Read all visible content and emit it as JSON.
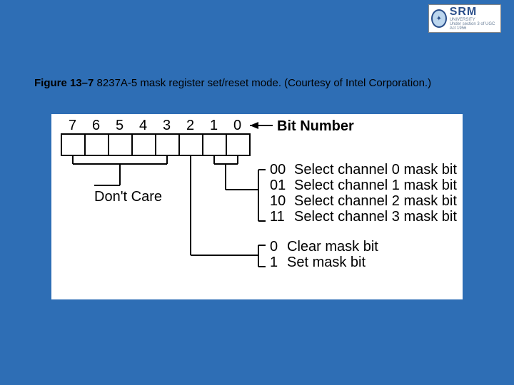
{
  "logo": {
    "main": "SRM",
    "sub": "UNIVERSITY",
    "tag": "Under section 3 of UGC Act 1956"
  },
  "caption": {
    "fignum": "Figure 13–7",
    "text": "  8237A-5 mask register set/reset mode. (Courtesy of Intel Corporation.)"
  },
  "diagram": {
    "bitnum_label": "Bit Number",
    "bits": [
      "7",
      "6",
      "5",
      "4",
      "3",
      "2",
      "1",
      "0"
    ],
    "dont_care": "Don't Care",
    "sel": {
      "00": "Select channel 0 mask bit",
      "01": "Select channel 1 mask bit",
      "10": "Select channel 2 mask bit",
      "11": "Select channel 3 mask bit"
    },
    "mask": {
      "0": "Clear mask bit",
      "1": "Set mask bit"
    }
  },
  "chart_data": {
    "type": "table",
    "title": "8237A-5 mask register set/reset mode",
    "bits": [
      7,
      6,
      5,
      4,
      3,
      2,
      1,
      0
    ],
    "fields": [
      {
        "bits": "7-3",
        "name": "Don't Care"
      },
      {
        "bits": "1-0",
        "name": "Select channel",
        "values": {
          "00": "channel 0 mask bit",
          "01": "channel 1 mask bit",
          "10": "channel 2 mask bit",
          "11": "channel 3 mask bit"
        }
      },
      {
        "bits": "2",
        "name": "Set/Clear",
        "values": {
          "0": "Clear mask bit",
          "1": "Set mask bit"
        }
      }
    ]
  }
}
